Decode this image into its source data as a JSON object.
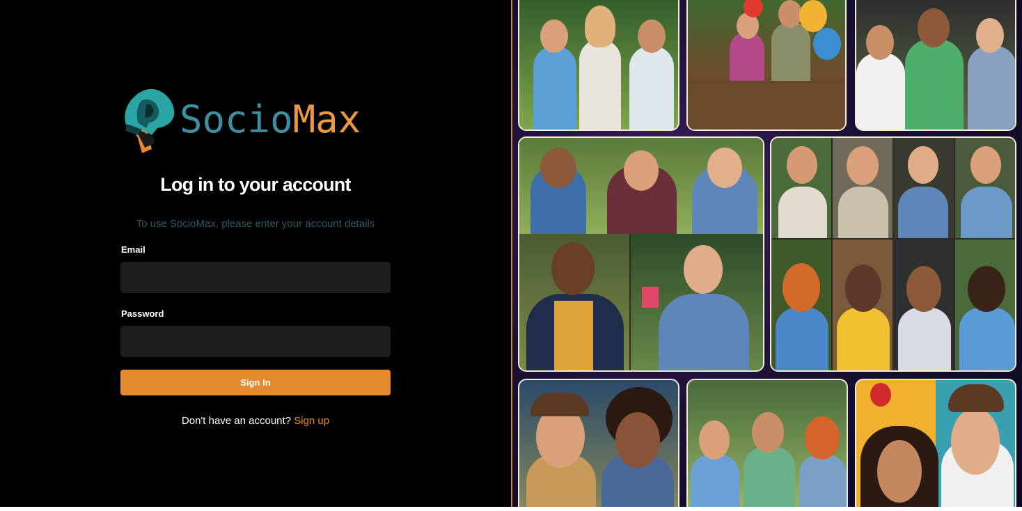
{
  "brand": {
    "name_part1": "Socio",
    "name_part2": "Max"
  },
  "login": {
    "title": "Log in to your account",
    "subtitle": "To use SocioMax, please enter your account details",
    "email_label": "Email",
    "email_value": "",
    "password_label": "Password",
    "password_value": "",
    "sign_in_label": "Sign In",
    "no_account_text": "Don't have an account?",
    "sign_up_label": "Sign up"
  },
  "colors": {
    "accent": "#e68a2e",
    "background": "#000000",
    "input_background": "#1e1e20",
    "logo_teal": "#3d8fa0",
    "subtitle": "#2e5866"
  },
  "collage": {
    "description_icon": "people-photo-collage"
  }
}
